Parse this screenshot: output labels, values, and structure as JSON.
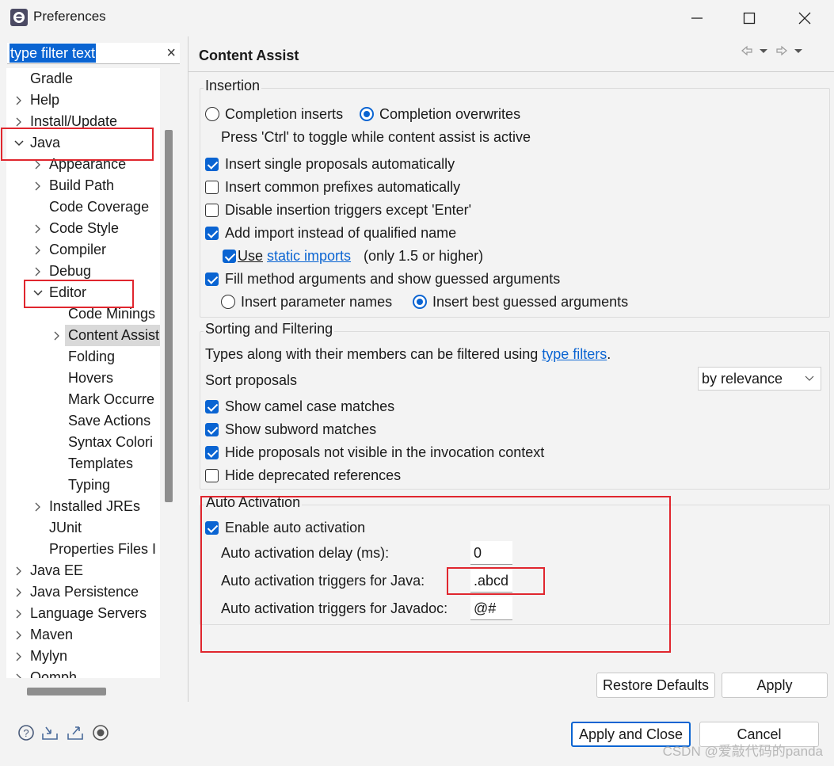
{
  "window": {
    "title": "Preferences"
  },
  "filter": {
    "text": "type filter text",
    "clear": "×"
  },
  "tree": {
    "gradle": "Gradle",
    "help": "Help",
    "install_update": "Install/Update",
    "java": "Java",
    "appearance": "Appearance",
    "build_path": "Build Path",
    "code_coverage": "Code Coverage",
    "code_style": "Code Style",
    "compiler": "Compiler",
    "debug": "Debug",
    "editor": "Editor",
    "code_minings": "Code Minings",
    "content_assist": "Content Assist",
    "folding": "Folding",
    "hovers": "Hovers",
    "mark_occurrences": "Mark Occurre",
    "save_actions": "Save Actions",
    "syntax_coloring": "Syntax Colori",
    "templates": "Templates",
    "typing": "Typing",
    "installed_jres": "Installed JREs",
    "junit": "JUnit",
    "properties_files": "Properties Files I",
    "java_ee": "Java EE",
    "java_persistence": "Java Persistence",
    "language_servers": "Language Servers",
    "maven": "Maven",
    "mylyn": "Mylyn",
    "oomph": "Oomph"
  },
  "page": {
    "title": "Content Assist"
  },
  "insertion": {
    "label": "Insertion",
    "completion_inserts": "Completion inserts",
    "completion_overwrites": "Completion overwrites",
    "toggle_hint": "Press 'Ctrl' to toggle while content assist is active",
    "insert_single": "Insert single proposals automatically",
    "insert_common": "Insert common prefixes automatically",
    "disable_triggers": "Disable insertion triggers except 'Enter'",
    "add_import": "Add import instead of qualified name",
    "use": "Use",
    "static_imports": "static imports",
    "only15": "(only 1.5 or higher)",
    "fill_method_args": "Fill method arguments and show guessed arguments",
    "insert_param_names": "Insert parameter names",
    "insert_best_guessed": "Insert best guessed arguments"
  },
  "sorting": {
    "label": "Sorting and Filtering",
    "types_text": "Types along with their members can be filtered using",
    "type_filters": "type filters",
    "period": ".",
    "sort_proposals": "Sort proposals",
    "sort_value": "by relevance",
    "camel_case": "Show camel case matches",
    "subword": "Show subword matches",
    "hide_not_visible": "Hide proposals not visible in the invocation context",
    "hide_deprecated": "Hide deprecated references"
  },
  "auto": {
    "label": "Auto Activation",
    "enable": "Enable auto activation",
    "delay_label": "Auto activation delay (ms):",
    "delay_value": "0",
    "java_label": "Auto activation triggers for Java:",
    "java_value": ".abcd",
    "javadoc_label": "Auto activation triggers for Javadoc:",
    "javadoc_value": "@#"
  },
  "buttons": {
    "restore_defaults": "Restore Defaults",
    "apply": "Apply",
    "apply_and_close": "Apply and Close",
    "cancel": "Cancel"
  },
  "watermark": "CSDN @爱敲代码的panda",
  "colors": {
    "accent": "#0a64d2",
    "highlight_box": "#e0262e"
  }
}
